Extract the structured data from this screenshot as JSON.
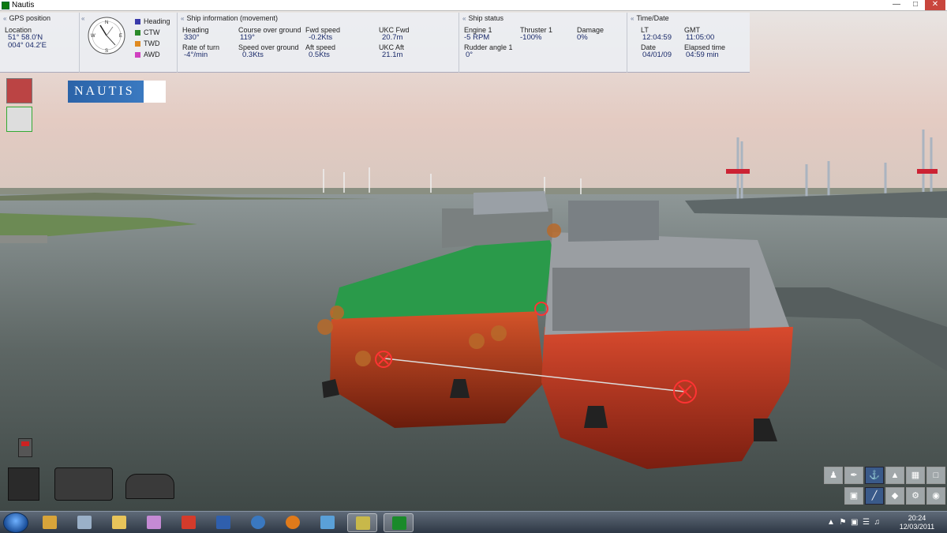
{
  "window": {
    "title": "Nautis"
  },
  "gps": {
    "section_title": "GPS position",
    "location_label": "Location",
    "lat": "51° 58.0'N",
    "lon": "004° 04.2'E"
  },
  "compass": {
    "heading_label": "Heading",
    "ctw_label": "CTW",
    "twd_label": "TWD",
    "awd_label": "AWD",
    "colors": {
      "heading": "#3a3aaa",
      "ctw": "#2a8a2a",
      "twd": "#e08a20",
      "awd": "#d040c0"
    }
  },
  "movement": {
    "section_title": "Ship information (movement)",
    "heading_label": "Heading",
    "heading_value": "330°",
    "rot_label": "Rate of turn",
    "rot_value": "-4°/min",
    "cog_label": "Course over ground",
    "cog_value": "119°",
    "sog_label": "Speed over ground",
    "sog_value": "0.3Kts",
    "fwd_label": "Fwd speed",
    "fwd_value": "-0.2Kts",
    "aft_label": "Aft speed",
    "aft_value": "0.5Kts",
    "ukc_fwd_label": "UKC Fwd",
    "ukc_fwd_value": "20.7m",
    "ukc_aft_label": "UKC Aft",
    "ukc_aft_value": "21.1m"
  },
  "status": {
    "section_title": "Ship status",
    "engine_label": "Engine 1",
    "engine_value": "-5 RPM",
    "thruster_label": "Thruster 1",
    "thruster_value": "-100%",
    "damage_label": "Damage",
    "damage_value": "0%",
    "rudder_label": "Rudder angle 1",
    "rudder_value": "0°"
  },
  "time": {
    "section_title": "Time/Date",
    "lt_label": "LT",
    "lt_value": "12:04:59",
    "gmt_label": "GMT",
    "gmt_value": "11:05:00",
    "date_label": "Date",
    "date_value": "04/01/09",
    "elapsed_label": "Elapsed time",
    "elapsed_value": "04:59 min"
  },
  "logo": {
    "text": "NAUTIS"
  },
  "taskbar": {
    "clock_time": "20:24",
    "clock_date": "12/03/2011",
    "apps": [
      "folder",
      "calculator",
      "explorer",
      "paint",
      "acrobat",
      "word",
      "thunderbird",
      "firefox",
      "notes",
      "cheque",
      "nautis"
    ]
  },
  "toolbar": {
    "icons": [
      "person-icon",
      "pen-icon",
      "anchor-icon",
      "tug-icon",
      "mooring-icon",
      "box-icon",
      "grid-icon",
      "line-icon",
      "ship-icon",
      "settings-icon",
      "eye-icon"
    ]
  }
}
